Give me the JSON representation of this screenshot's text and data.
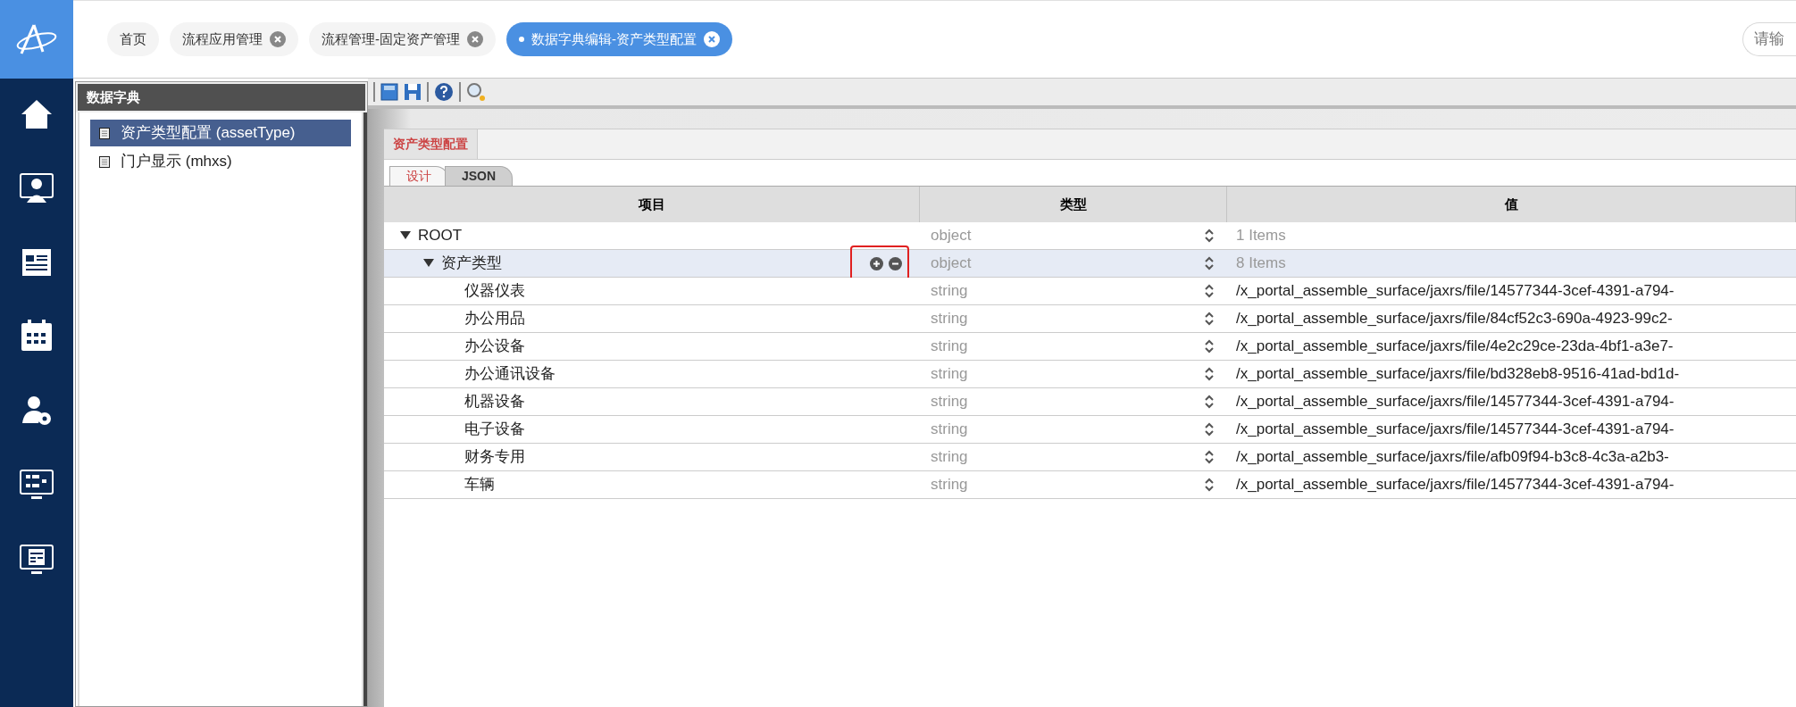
{
  "top_tabs": [
    {
      "label": "首页",
      "closable": false,
      "selected": false
    },
    {
      "label": "流程应用管理",
      "closable": true,
      "selected": false
    },
    {
      "label": "流程管理-固定资产管理",
      "closable": true,
      "selected": false
    },
    {
      "label": "数据字典编辑-资产类型配置",
      "closable": true,
      "selected": true
    }
  ],
  "search": {
    "placeholder": "请输"
  },
  "dictionary_panel": {
    "title": "数据字典",
    "items": [
      {
        "label": "资产类型配置 (assetType)",
        "selected": true
      },
      {
        "label": "门户显示 (mhxs)",
        "selected": false
      }
    ]
  },
  "editor": {
    "title": "资产类型配置",
    "view_tabs": [
      {
        "label": "设计",
        "selected": true
      },
      {
        "label": "JSON",
        "selected": false
      }
    ],
    "columns": [
      "项目",
      "类型",
      "值"
    ],
    "tree": [
      {
        "name": "ROOT",
        "type": "object",
        "value": "1 Items",
        "expanded": true,
        "selected": false,
        "children": [
          {
            "name": "资产类型",
            "type": "object",
            "value": "8 Items",
            "expanded": true,
            "selected": true,
            "show_actions": true,
            "highlighted": true,
            "children": [
              {
                "name": "仪器仪表",
                "type": "string",
                "value": "/x_portal_assemble_surface/jaxrs/file/14577344-3cef-4391-a794-"
              },
              {
                "name": "办公用品",
                "type": "string",
                "value": "/x_portal_assemble_surface/jaxrs/file/84cf52c3-690a-4923-99c2-"
              },
              {
                "name": "办公设备",
                "type": "string",
                "value": "/x_portal_assemble_surface/jaxrs/file/4e2c29ce-23da-4bf1-a3e7-"
              },
              {
                "name": "办公通讯设备",
                "type": "string",
                "value": "/x_portal_assemble_surface/jaxrs/file/bd328eb8-9516-41ad-bd1d-"
              },
              {
                "name": "机器设备",
                "type": "string",
                "value": "/x_portal_assemble_surface/jaxrs/file/14577344-3cef-4391-a794-"
              },
              {
                "name": "电子设备",
                "type": "string",
                "value": "/x_portal_assemble_surface/jaxrs/file/14577344-3cef-4391-a794-"
              },
              {
                "name": "财务专用",
                "type": "string",
                "value": "/x_portal_assemble_surface/jaxrs/file/afb09f94-b3c8-4c3a-a2b3-"
              },
              {
                "name": "车辆",
                "type": "string",
                "value": "/x_portal_assemble_surface/jaxrs/file/14577344-3cef-4391-a794-"
              }
            ]
          }
        ]
      }
    ]
  }
}
